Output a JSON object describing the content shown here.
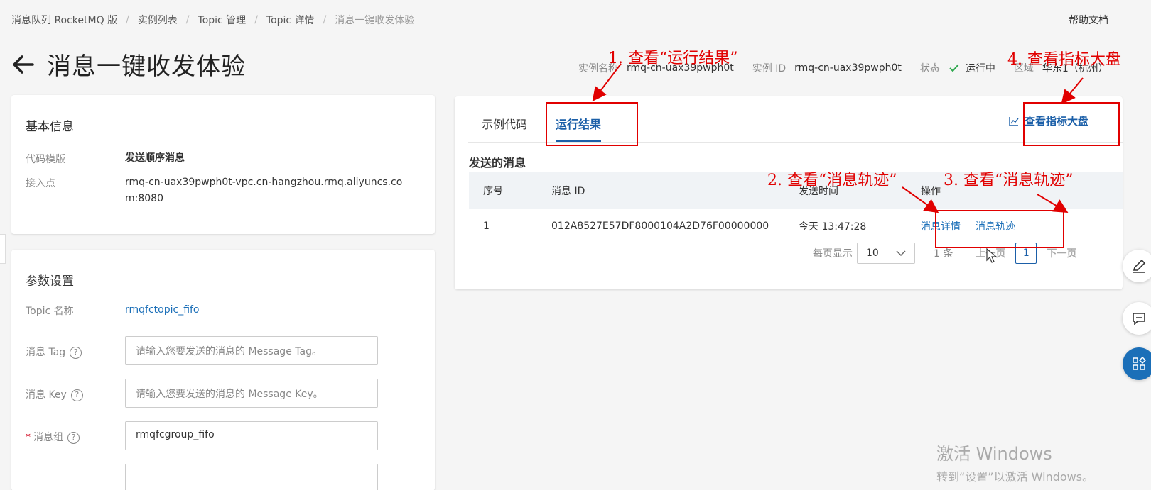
{
  "breadcrumb": [
    "消息队列 RocketMQ 版",
    "实例列表",
    "Topic 管理",
    "Topic 详情",
    "消息一键收发体验"
  ],
  "help_doc": "帮助文档",
  "page_title": "消息一键收发体验",
  "meta": {
    "instance_name_label": "实例名称",
    "instance_name": "rmq-cn-uax39pwph0t",
    "instance_id_label": "实例 ID",
    "instance_id": "rmq-cn-uax39pwph0t",
    "status_label": "状态",
    "status": "运行中",
    "region_label": "区域",
    "region": "华东1（杭州）"
  },
  "basic": {
    "title": "基本信息",
    "template_label": "代码模版",
    "template_value": "发送顺序消息",
    "endpoint_label": "接入点",
    "endpoint_value": "rmq-cn-uax39pwph0t-vpc.cn-hangzhou.rmq.aliyuncs.com:8080"
  },
  "params": {
    "title": "参数设置",
    "topic_label": "Topic 名称",
    "topic_value": "rmqfctopic_fifo",
    "tag_label": "消息 Tag",
    "tag_placeholder": "请输入您要发送的消息的 Message Tag。",
    "key_label": "消息 Key",
    "key_placeholder": "请输入您要发送的消息的 Message Key。",
    "group_label": "消息组",
    "group_value": "rmqfcgroup_fifo",
    "required_mark": "*",
    "help_mark": "?"
  },
  "tabs": [
    "示例代码",
    "运行结果"
  ],
  "dashboard_button": "查看指标大盘",
  "sent_messages": {
    "title": "发送的消息",
    "columns": [
      "序号",
      "消息 ID",
      "发送时间",
      "操作"
    ],
    "rows": [
      {
        "index": "1",
        "message_id": "012A8527E57DF8000104A2D76F00000000",
        "time": "今天 13:47:28",
        "detail": "消息详情",
        "trace": "消息轨迹"
      }
    ]
  },
  "pager": {
    "per_page_label": "每页显示",
    "per_page": "10",
    "total": "1 条",
    "prev": "上一页",
    "page": "1",
    "next": "下一页"
  },
  "annotations": {
    "a1": "1. 查看“运行结果”",
    "a2": "2. 查看“消息轨迹”",
    "a3": "3. 查看“消息轨迹”",
    "a4": "4. 查看指标大盘"
  },
  "watermark": {
    "line1": "激活 Windows",
    "line2": "转到“设置”以激活 Windows。"
  },
  "colors": {
    "accent": "#1b5fa8",
    "annotation_red": "#e10000",
    "status_green": "#2fa84f"
  }
}
